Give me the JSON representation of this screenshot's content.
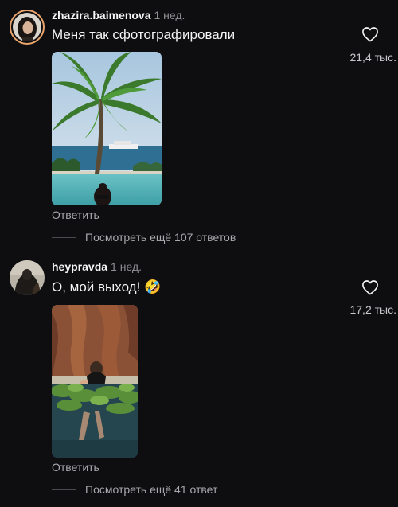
{
  "comments": [
    {
      "username": "zhazira.baimenova",
      "time": "1 нед.",
      "text": "Меня так сфотографировали",
      "likes": "21,4 тыс.",
      "reply_label": "Ответить",
      "view_replies": "Посмотреть ещё 107 ответов",
      "photo": "palm-tree-infinity-pool-photo"
    },
    {
      "username": "heypravda",
      "time": "1 нед.",
      "text": "О, мой выход!",
      "emoji": "🤣",
      "likes": "17,2 тыс.",
      "reply_label": "Ответить",
      "view_replies": "Посмотреть ещё 41 ответ",
      "photo": "rock-pool-plants-photo"
    }
  ],
  "colors": {
    "background": "#0e0e10",
    "primary_text": "#f5f5f5",
    "secondary_text": "#8e8e93",
    "story_ring": "#e9a36b"
  },
  "icons": [
    "heart-icon"
  ]
}
